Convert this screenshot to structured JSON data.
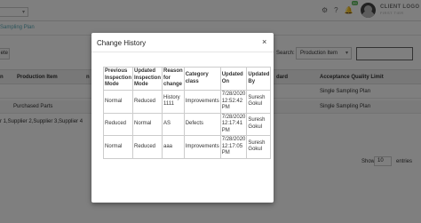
{
  "header": {
    "client_logo": "CLIENT LOGO",
    "client_sub": "FIRST TIER",
    "notification_count": "99"
  },
  "breadcrumb": "Sampling Plan",
  "toolbar": {
    "button_label": "ete"
  },
  "search": {
    "label": "Search:",
    "selected_option": "Production Item",
    "value": ""
  },
  "background_table": {
    "headers": [
      "n",
      "Production Item",
      "n",
      "dard",
      "Acceptance Quality Limit"
    ],
    "rows": [
      {
        "c0": "",
        "c1": "",
        "c3": "",
        "c4": "Single Sampling Plan"
      },
      {
        "c0": "",
        "c1": "Purchased Parts",
        "c3": "",
        "c4": "Single Sampling Plan"
      }
    ],
    "supplier_line": "r 1,Supplier 2,Supplier 3,Supplier 4"
  },
  "pagination": {
    "show_label": "Show",
    "page_size": "10",
    "entries_label": "entries"
  },
  "modal": {
    "title": "Change History",
    "close_symbol": "×",
    "columns": [
      "Previous Inspection Mode",
      "Updated Inspection Mode",
      "Reason for change",
      "Category class",
      "Updated On",
      "Updated By"
    ],
    "rows": [
      [
        "Normal",
        "Reduced",
        "History 1111",
        "Improvements",
        "7/28/2020 12:52:42 PM",
        "Suresh Gokul"
      ],
      [
        "Reduced",
        "Normal",
        "AS",
        "Defects",
        "7/28/2020 12:17:41 PM",
        "Suresh Gokul"
      ],
      [
        "Normal",
        "Reduced",
        "aaa",
        "Improvements",
        "7/28/2020 12:17:05 PM",
        "Suresh Gokul"
      ]
    ]
  }
}
